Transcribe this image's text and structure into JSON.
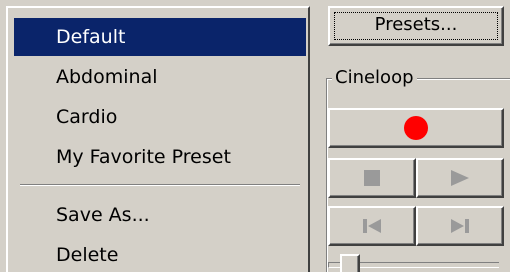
{
  "menu": {
    "items": [
      {
        "label": "Default",
        "selected": true
      },
      {
        "label": "Abdominal",
        "selected": false
      },
      {
        "label": "Cardio",
        "selected": false
      },
      {
        "label": "My Favorite Preset",
        "selected": false
      }
    ],
    "actions": [
      {
        "label": "Save As..."
      },
      {
        "label": "Delete"
      }
    ]
  },
  "panel": {
    "presets_button_label": "Presets...",
    "cineloop_group_title": "Cineloop",
    "controls": {
      "record_icon": "record-icon",
      "stop_icon": "stop-icon",
      "play_icon": "play-icon",
      "skip_start_icon": "skip-to-start-icon",
      "skip_end_icon": "skip-to-end-icon",
      "record_color": "#ff0000",
      "disabled_icon_color": "#9a9a9a"
    }
  },
  "colors": {
    "selection_bg": "#0a246a",
    "selection_fg": "#ffffff",
    "face": "#d4d0c8"
  }
}
